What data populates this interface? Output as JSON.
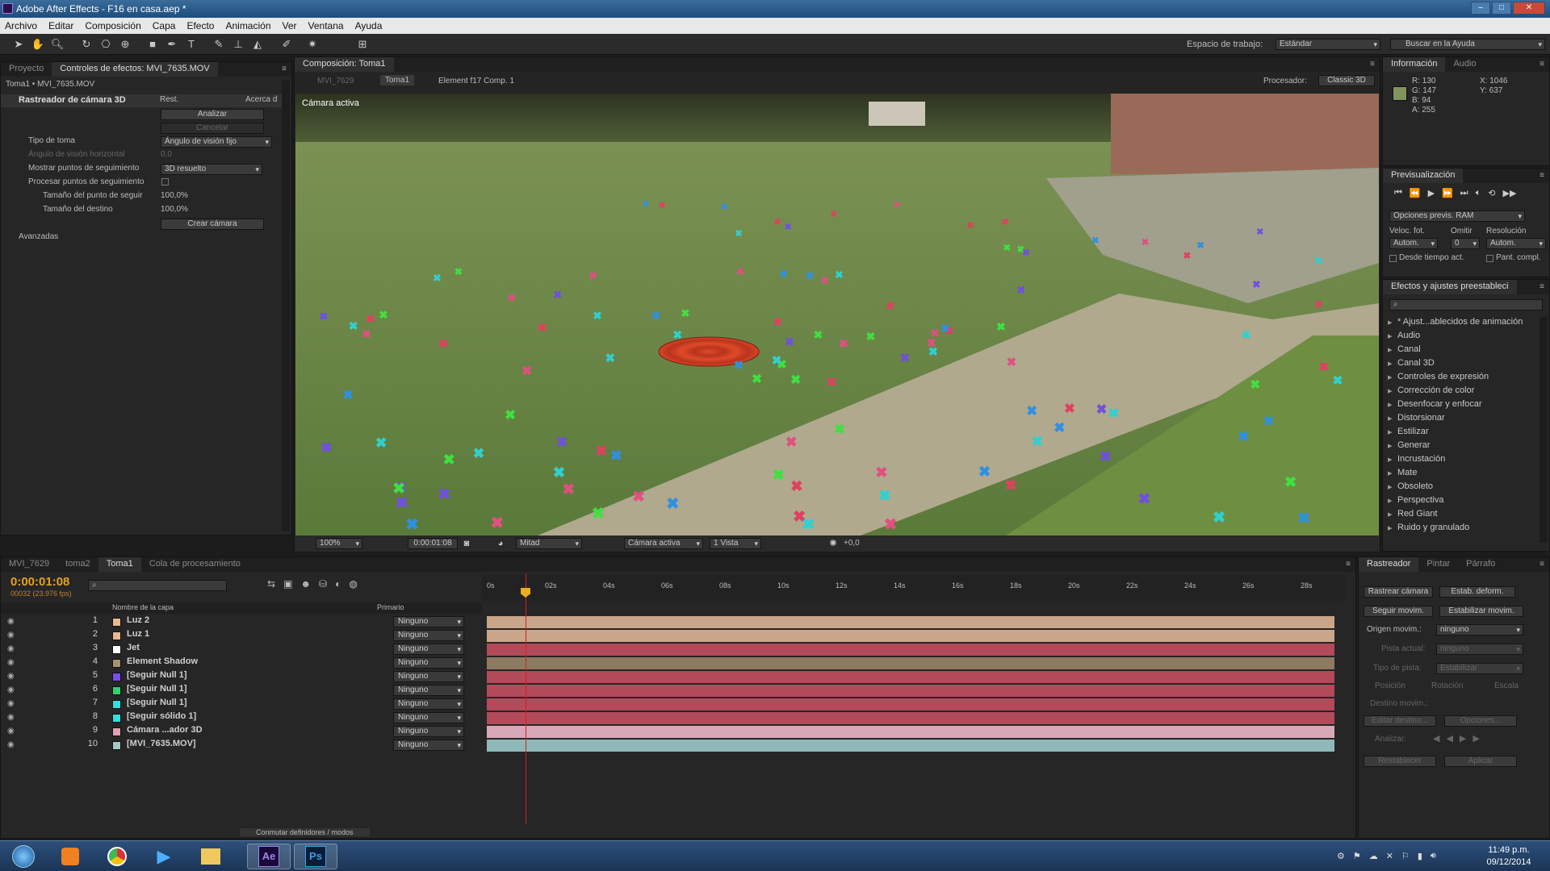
{
  "app": {
    "title": "Adobe After Effects - F16 en casa.aep *"
  },
  "menu": [
    "Archivo",
    "Editar",
    "Composición",
    "Capa",
    "Efecto",
    "Animación",
    "Ver",
    "Ventana",
    "Ayuda"
  ],
  "toolbar": {
    "workspace_label": "Espacio de trabajo:",
    "workspace_value": "Estándar",
    "help_placeholder": "Buscar en la Ayuda"
  },
  "effects_panel": {
    "tabs": [
      "Proyecto",
      "Controles de efectos: MVI_7635.MOV"
    ],
    "breadcrumb": "Toma1 • MVI_7635.MOV",
    "effect_name": "Rastreador de cámara 3D",
    "reset": "Rest.",
    "about": "Acerca d",
    "analyze": "Analizar",
    "cancel": "Cancelar",
    "shot_type_label": "Tipo de toma",
    "shot_type_value": "Ángulo de visión fijo",
    "hfov_label": "Ángulo de visión horizontal",
    "hfov_value": "0,0",
    "show_points_label": "Mostrar puntos de seguimiento",
    "show_points_value": "3D resuelto",
    "process_label": "Procesar puntos de seguimiento",
    "point_size_label": "Tamaño del punto de seguir",
    "point_size_value": "100,0%",
    "target_size_label": "Tamaño del destino",
    "target_size_value": "100,0%",
    "create_camera": "Crear cámara",
    "advanced": "Avanzadas"
  },
  "comp": {
    "tab": "Composición: Toma1",
    "crumbs": [
      "MVI_7629",
      "Toma1",
      "Element f17 Comp. 1"
    ],
    "renderer_label": "Procesador:",
    "renderer_value": "Classic 3D",
    "view_label": "Cámara activa",
    "footer": {
      "zoom": "100%",
      "time": "0:00:01:08",
      "resolution": "Mitad",
      "camera": "Cámara activa",
      "views": "1 Vista",
      "exposure": "+0,0"
    }
  },
  "info": {
    "tabs": [
      "Información",
      "Audio"
    ],
    "r": "R: 130",
    "g": "G: 147",
    "b": "B: 94",
    "a": "A: 255",
    "x": "X: 1046",
    "y": "Y: 637",
    "color": "#82935e"
  },
  "preview": {
    "tab": "Previsualización",
    "ram": "Opciones previs. RAM",
    "fps_label": "Veloc. fot.",
    "skip_label": "Omitir",
    "res_label": "Resolución",
    "fps": "Autom.",
    "skip": "0",
    "res": "Autom.",
    "from_current": "Desde tiempo act.",
    "full": "Pant. compl."
  },
  "effects_presets": {
    "tab": "Efectos y ajustes preestableci",
    "items": [
      "* Ajust...ablecidos de animación",
      "Audio",
      "Canal",
      "Canal 3D",
      "Controles de expresión",
      "Corrección de color",
      "Desenfocar y enfocar",
      "Distorsionar",
      "Estilizar",
      "Generar",
      "Incrustación",
      "Mate",
      "Obsoleto",
      "Perspectiva",
      "Red Giant",
      "Ruido y granulado"
    ]
  },
  "timeline": {
    "tabs": [
      "MVI_7629",
      "toma2",
      "Toma1",
      "Cola de procesamiento"
    ],
    "timecode": "0:00:01:08",
    "frames": "00032 (23.976 fps)",
    "col_name": "Nombre de la capa",
    "col_parent": "Primario",
    "ticks": [
      "0s",
      "02s",
      "04s",
      "06s",
      "08s",
      "10s",
      "12s",
      "14s",
      "16s",
      "18s",
      "20s",
      "22s",
      "24s",
      "26s",
      "28s"
    ],
    "toggle": "Conmutar definidores / modos",
    "layers": [
      {
        "n": "1",
        "name": "Luz 2",
        "sw": "#e8b890",
        "bar": "#c9a58a",
        "parent": "Ninguno"
      },
      {
        "n": "2",
        "name": "Luz 1",
        "sw": "#e8b890",
        "bar": "#c9a58a",
        "parent": "Ninguno"
      },
      {
        "n": "3",
        "name": "Jet",
        "sw": "#ffffff",
        "bar": "#b24a5a",
        "parent": "Ninguno"
      },
      {
        "n": "4",
        "name": "Element Shadow",
        "sw": "#a89070",
        "bar": "#8e7a62",
        "parent": "Ninguno"
      },
      {
        "n": "5",
        "name": "[Seguir Null 1]",
        "sw": "#7a4cf0",
        "bar": "#b24a5a",
        "parent": "Ninguno"
      },
      {
        "n": "6",
        "name": "[Seguir Null 1]",
        "sw": "#30d070",
        "bar": "#b24a5a",
        "parent": "Ninguno"
      },
      {
        "n": "7",
        "name": "[Seguir Null 1]",
        "sw": "#30e0e0",
        "bar": "#b24a5a",
        "parent": "Ninguno"
      },
      {
        "n": "8",
        "name": "[Seguir sólido 1]",
        "sw": "#30e0e0",
        "bar": "#b24a5a",
        "parent": "Ninguno"
      },
      {
        "n": "9",
        "name": "Cámara ...ador 3D",
        "sw": "#e0a0b8",
        "bar": "#d8a8b8",
        "parent": "Ninguno"
      },
      {
        "n": "10",
        "name": "[MVI_7635.MOV]",
        "sw": "#a8c8c8",
        "bar": "#8fb8b8",
        "parent": "Ninguno"
      }
    ]
  },
  "tracker": {
    "tabs": [
      "Rastreador",
      "Pintar",
      "Párrafo"
    ],
    "track_camera": "Rastrear cámara",
    "warp": "Estab. deform.",
    "track_motion": "Seguir movim.",
    "stabilize": "Estabilizar movim.",
    "source_label": "Origen movim.:",
    "source_value": "ninguno",
    "current_track": "Pista actual:",
    "current_value": "ninguno",
    "track_type": "Tipo de pista:",
    "track_type_value": "Estabilizar",
    "position": "Posición",
    "rotation": "Rotación",
    "scale": "Escala",
    "target": "Destino movim.:",
    "edit_target": "Editar destino...",
    "options": "Opciones...",
    "analyze": "Analizar:",
    "reset": "Restablecer",
    "apply": "Aplicar"
  },
  "taskbar": {
    "time": "11:49 p.m.",
    "date": "09/12/2014"
  }
}
